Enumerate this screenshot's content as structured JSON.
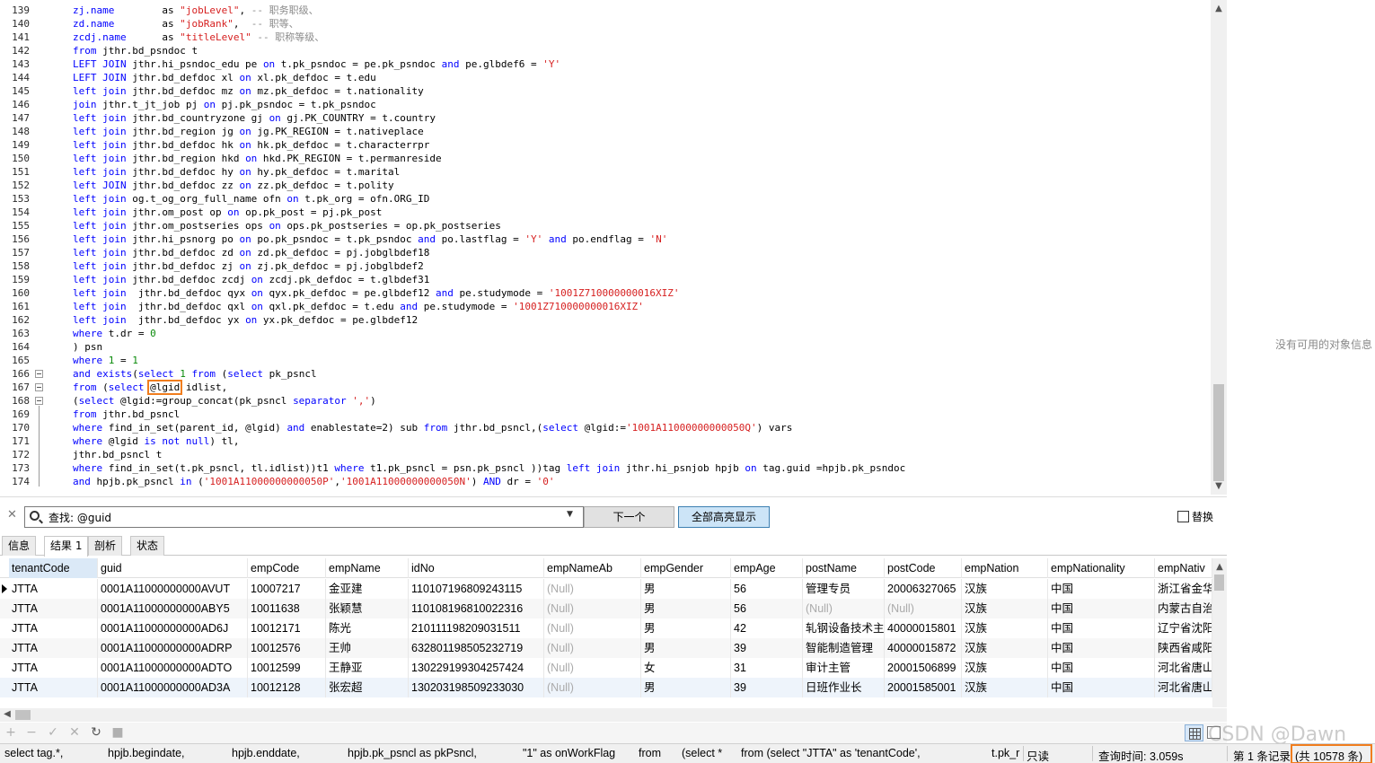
{
  "editor": {
    "lines": [
      {
        "n": "139",
        "segs": [
          {
            "t": "zj.name",
            "c": "kw"
          },
          {
            "t": "        as "
          },
          {
            "t": "\"jobLevel\"",
            "c": "str"
          },
          {
            "t": ", "
          },
          {
            "t": "-- 职务职级、",
            "c": "cm"
          }
        ]
      },
      {
        "n": "140",
        "segs": [
          {
            "t": "zd.name",
            "c": "kw"
          },
          {
            "t": "        as "
          },
          {
            "t": "\"jobRank\"",
            "c": "str"
          },
          {
            "t": ",  "
          },
          {
            "t": "-- 职等、",
            "c": "cm"
          }
        ]
      },
      {
        "n": "141",
        "segs": [
          {
            "t": "zcdj.name",
            "c": "kw"
          },
          {
            "t": "      as "
          },
          {
            "t": "\"titleLevel\"",
            "c": "str"
          },
          {
            "t": " "
          },
          {
            "t": "-- 职称等级、",
            "c": "cm"
          }
        ]
      },
      {
        "n": "142",
        "segs": [
          {
            "t": "from",
            "c": "kw"
          },
          {
            "t": " jthr.bd_psndoc t"
          }
        ]
      },
      {
        "n": "143",
        "segs": [
          {
            "t": "LEFT JOIN",
            "c": "kw"
          },
          {
            "t": " jthr.hi_psndoc_edu pe "
          },
          {
            "t": "on",
            "c": "kw"
          },
          {
            "t": " t.pk_psndoc = pe.pk_psndoc "
          },
          {
            "t": "and",
            "c": "kw"
          },
          {
            "t": " pe.glbdef6 = "
          },
          {
            "t": "'Y'",
            "c": "str"
          }
        ]
      },
      {
        "n": "144",
        "segs": [
          {
            "t": "LEFT JOIN",
            "c": "kw"
          },
          {
            "t": " jthr.bd_defdoc xl "
          },
          {
            "t": "on",
            "c": "kw"
          },
          {
            "t": " xl.pk_defdoc = t.edu"
          }
        ]
      },
      {
        "n": "145",
        "segs": [
          {
            "t": "left join",
            "c": "kw"
          },
          {
            "t": " jthr.bd_defdoc mz "
          },
          {
            "t": "on",
            "c": "kw"
          },
          {
            "t": " mz.pk_defdoc = t.nationality"
          }
        ]
      },
      {
        "n": "146",
        "segs": [
          {
            "t": "join",
            "c": "kw"
          },
          {
            "t": " jthr.t_jt_job pj "
          },
          {
            "t": "on",
            "c": "kw"
          },
          {
            "t": " pj.pk_psndoc = t.pk_psndoc"
          }
        ]
      },
      {
        "n": "147",
        "segs": [
          {
            "t": "left join",
            "c": "kw"
          },
          {
            "t": " jthr.bd_countryzone gj "
          },
          {
            "t": "on",
            "c": "kw"
          },
          {
            "t": " gj.PK_COUNTRY = t.country"
          }
        ]
      },
      {
        "n": "148",
        "segs": [
          {
            "t": "left join",
            "c": "kw"
          },
          {
            "t": " jthr.bd_region jg "
          },
          {
            "t": "on",
            "c": "kw"
          },
          {
            "t": " jg.PK_REGION = t.nativeplace"
          }
        ]
      },
      {
        "n": "149",
        "segs": [
          {
            "t": "left join",
            "c": "kw"
          },
          {
            "t": " jthr.bd_defdoc hk "
          },
          {
            "t": "on",
            "c": "kw"
          },
          {
            "t": " hk.pk_defdoc = t.characterrpr"
          }
        ]
      },
      {
        "n": "150",
        "segs": [
          {
            "t": "left join",
            "c": "kw"
          },
          {
            "t": " jthr.bd_region hkd "
          },
          {
            "t": "on",
            "c": "kw"
          },
          {
            "t": " hkd.PK_REGION = t.permanreside"
          }
        ]
      },
      {
        "n": "151",
        "segs": [
          {
            "t": "left join",
            "c": "kw"
          },
          {
            "t": " jthr.bd_defdoc hy "
          },
          {
            "t": "on",
            "c": "kw"
          },
          {
            "t": " hy.pk_defdoc = t.marital"
          }
        ]
      },
      {
        "n": "152",
        "segs": [
          {
            "t": "left JOIN",
            "c": "kw"
          },
          {
            "t": " jthr.bd_defdoc zz "
          },
          {
            "t": "on",
            "c": "kw"
          },
          {
            "t": " zz.pk_defdoc = t.polity"
          }
        ]
      },
      {
        "n": "153",
        "segs": [
          {
            "t": "left join",
            "c": "kw"
          },
          {
            "t": " og.t_og_org_full_name ofn "
          },
          {
            "t": "on",
            "c": "kw"
          },
          {
            "t": " t.pk_org = ofn.ORG_ID"
          }
        ]
      },
      {
        "n": "154",
        "segs": [
          {
            "t": "left join",
            "c": "kw"
          },
          {
            "t": " jthr.om_post op "
          },
          {
            "t": "on",
            "c": "kw"
          },
          {
            "t": " op.pk_post = pj.pk_post"
          }
        ]
      },
      {
        "n": "155",
        "segs": [
          {
            "t": "left join",
            "c": "kw"
          },
          {
            "t": " jthr.om_postseries ops "
          },
          {
            "t": "on",
            "c": "kw"
          },
          {
            "t": " ops.pk_postseries = op.pk_postseries"
          }
        ]
      },
      {
        "n": "156",
        "segs": [
          {
            "t": "left join",
            "c": "kw"
          },
          {
            "t": " jthr.hi_psnorg po "
          },
          {
            "t": "on",
            "c": "kw"
          },
          {
            "t": " po.pk_psndoc = t.pk_psndoc "
          },
          {
            "t": "and",
            "c": "kw"
          },
          {
            "t": " po.lastflag = "
          },
          {
            "t": "'Y'",
            "c": "str"
          },
          {
            "t": " "
          },
          {
            "t": "and",
            "c": "kw"
          },
          {
            "t": " po.endflag = "
          },
          {
            "t": "'N'",
            "c": "str"
          }
        ]
      },
      {
        "n": "157",
        "segs": [
          {
            "t": "left join",
            "c": "kw"
          },
          {
            "t": " jthr.bd_defdoc zd "
          },
          {
            "t": "on",
            "c": "kw"
          },
          {
            "t": " zd.pk_defdoc = pj.jobglbdef18"
          }
        ]
      },
      {
        "n": "158",
        "segs": [
          {
            "t": "left join",
            "c": "kw"
          },
          {
            "t": " jthr.bd_defdoc zj "
          },
          {
            "t": "on",
            "c": "kw"
          },
          {
            "t": " zj.pk_defdoc = pj.jobglbdef2"
          }
        ]
      },
      {
        "n": "159",
        "segs": [
          {
            "t": "left join",
            "c": "kw"
          },
          {
            "t": " jthr.bd_defdoc zcdj "
          },
          {
            "t": "on",
            "c": "kw"
          },
          {
            "t": " zcdj.pk_defdoc = t.glbdef31"
          }
        ]
      },
      {
        "n": "160",
        "segs": [
          {
            "t": "left join",
            "c": "kw"
          },
          {
            "t": "  jthr.bd_defdoc qyx "
          },
          {
            "t": "on",
            "c": "kw"
          },
          {
            "t": " qyx.pk_defdoc = pe.glbdef12 "
          },
          {
            "t": "and",
            "c": "kw"
          },
          {
            "t": " pe.studymode = "
          },
          {
            "t": "'1001Z710000000016XIZ'",
            "c": "str"
          }
        ]
      },
      {
        "n": "161",
        "segs": [
          {
            "t": "left join",
            "c": "kw"
          },
          {
            "t": "  jthr.bd_defdoc qxl "
          },
          {
            "t": "on",
            "c": "kw"
          },
          {
            "t": " qxl.pk_defdoc = t.edu "
          },
          {
            "t": "and",
            "c": "kw"
          },
          {
            "t": " pe.studymode = "
          },
          {
            "t": "'1001Z710000000016XIZ'",
            "c": "str"
          }
        ]
      },
      {
        "n": "162",
        "segs": [
          {
            "t": "left join",
            "c": "kw"
          },
          {
            "t": "  jthr.bd_defdoc yx "
          },
          {
            "t": "on",
            "c": "kw"
          },
          {
            "t": " yx.pk_defdoc = pe.glbdef12"
          }
        ]
      },
      {
        "n": "163",
        "segs": [
          {
            "t": "where",
            "c": "kw"
          },
          {
            "t": " t.dr = "
          },
          {
            "t": "0",
            "c": "num"
          }
        ]
      },
      {
        "n": "164",
        "segs": [
          {
            "t": ") psn"
          }
        ]
      },
      {
        "n": "165",
        "segs": [
          {
            "t": "where",
            "c": "kw"
          },
          {
            "t": " "
          },
          {
            "t": "1",
            "c": "num"
          },
          {
            "t": " = "
          },
          {
            "t": "1",
            "c": "num"
          }
        ]
      },
      {
        "n": "166",
        "segs": [
          {
            "t": "and exists",
            "c": "kw"
          },
          {
            "t": "("
          },
          {
            "t": "select",
            "c": "kw"
          },
          {
            "t": " "
          },
          {
            "t": "1",
            "c": "num"
          },
          {
            "t": " "
          },
          {
            "t": "from",
            "c": "kw"
          },
          {
            "t": " ("
          },
          {
            "t": "select",
            "c": "kw"
          },
          {
            "t": " pk_psncl"
          }
        ]
      },
      {
        "n": "167",
        "segs": [
          {
            "t": "from",
            "c": "kw"
          },
          {
            "t": " ("
          },
          {
            "t": "select",
            "c": "kw"
          },
          {
            "t": " "
          },
          {
            "t": "@lgid",
            "c": "box"
          },
          {
            "t": " idlist,"
          }
        ]
      },
      {
        "n": "168",
        "segs": [
          {
            "t": "("
          },
          {
            "t": "select",
            "c": "kw"
          },
          {
            "t": " @lgid:=group_concat(pk_psncl "
          },
          {
            "t": "separator",
            "c": "kw"
          },
          {
            "t": " "
          },
          {
            "t": "','",
            "c": "str"
          },
          {
            "t": ")"
          }
        ]
      },
      {
        "n": "169",
        "segs": [
          {
            "t": "from",
            "c": "kw"
          },
          {
            "t": " jthr.bd_psncl"
          }
        ]
      },
      {
        "n": "170",
        "segs": [
          {
            "t": "where",
            "c": "kw"
          },
          {
            "t": " find_in_set(parent_id, @lgid) "
          },
          {
            "t": "and",
            "c": "kw"
          },
          {
            "t": " enablestate=2) sub "
          },
          {
            "t": "from",
            "c": "kw"
          },
          {
            "t": " jthr.bd_psncl,("
          },
          {
            "t": "select",
            "c": "kw"
          },
          {
            "t": " @lgid:="
          },
          {
            "t": "'1001A11000000000050Q'",
            "c": "str"
          },
          {
            "t": ") vars"
          }
        ]
      },
      {
        "n": "171",
        "segs": [
          {
            "t": "where",
            "c": "kw"
          },
          {
            "t": " @lgid "
          },
          {
            "t": "is not null",
            "c": "kw"
          },
          {
            "t": ") tl,"
          }
        ]
      },
      {
        "n": "172",
        "segs": [
          {
            "t": "jthr.bd_psncl t"
          }
        ]
      },
      {
        "n": "173",
        "segs": [
          {
            "t": "where",
            "c": "kw"
          },
          {
            "t": " find_in_set(t.pk_psncl, tl.idlist))t1 "
          },
          {
            "t": "where",
            "c": "kw"
          },
          {
            "t": " t1.pk_psncl = psn.pk_psncl ))tag "
          },
          {
            "t": "left join",
            "c": "kw"
          },
          {
            "t": " jthr.hi_psnjob hpjb "
          },
          {
            "t": "on",
            "c": "kw"
          },
          {
            "t": " tag.guid =hpjb.pk_psndoc"
          }
        ]
      },
      {
        "n": "174",
        "segs": [
          {
            "t": "and",
            "c": "kw"
          },
          {
            "t": " hpjb.pk_psncl "
          },
          {
            "t": "in",
            "c": "kw"
          },
          {
            "t": " ("
          },
          {
            "t": "'1001A11000000000050P'",
            "c": "str"
          },
          {
            "t": ","
          },
          {
            "t": "'1001A11000000000050N'",
            "c": "str"
          },
          {
            "t": ") "
          },
          {
            "t": "AND",
            "c": "kw"
          },
          {
            "t": " dr = "
          },
          {
            "t": "'0'",
            "c": "str"
          }
        ]
      }
    ]
  },
  "right_pane": {
    "message": "没有可用的对象信息"
  },
  "find": {
    "value": "查找: @guid",
    "next_label": "下一个",
    "highlight_all_label": "全部高亮显示",
    "replace_label": "替换"
  },
  "tabs": [
    "信息",
    "结果 1",
    "剖析",
    "状态"
  ],
  "grid": {
    "columns": [
      "tenantCode",
      "guid",
      "empCode",
      "empName",
      "idNo",
      "empNameAb",
      "empGender",
      "empAge",
      "postName",
      "postCode",
      "empNation",
      "empNationality",
      "empNativ"
    ],
    "rows": [
      [
        "JTTA",
        "0001A11000000000AVUT",
        "10007217",
        "金亚建",
        "110107196809243115",
        "(Null)",
        "男",
        "56",
        "管理专员",
        "20006327065",
        "汉族",
        "中国",
        "浙江省金华"
      ],
      [
        "JTTA",
        "0001A11000000000ABY5",
        "10011638",
        "张颖慧",
        "110108196810022316",
        "(Null)",
        "男",
        "56",
        "(Null)",
        "(Null)",
        "汉族",
        "中国",
        "内蒙古自治"
      ],
      [
        "JTTA",
        "0001A11000000000AD6J",
        "10012171",
        "陈光",
        "210111198209031511",
        "(Null)",
        "男",
        "42",
        "轧钢设备技术主管",
        "40000015801",
        "汉族",
        "中国",
        "辽宁省沈阳"
      ],
      [
        "JTTA",
        "0001A11000000000ADRP",
        "10012576",
        "王帅",
        "632801198505232719",
        "(Null)",
        "男",
        "39",
        "智能制造管理",
        "40000015872",
        "汉族",
        "中国",
        "陕西省咸阳"
      ],
      [
        "JTTA",
        "0001A11000000000ADTO",
        "10012599",
        "王静亚",
        "130229199304257424",
        "(Null)",
        "女",
        "31",
        "审计主管",
        "20001506899",
        "汉族",
        "中国",
        "河北省唐山"
      ],
      [
        "JTTA",
        "0001A11000000000AD3A",
        "10012128",
        "张宏超",
        "130203198509233030",
        "(Null)",
        "男",
        "39",
        "日班作业长",
        "20001585001",
        "汉族",
        "中国",
        "河北省唐山"
      ]
    ]
  },
  "status": {
    "segments": [
      "select tag.*,",
      "hpjb.begindate,",
      "hpjb.enddate,",
      "hpjb.pk_psncl as pkPsncl,",
      "\"1\" as onWorkFlag",
      "from",
      "(select *",
      "from (select \"JTTA\" as 'tenantCode',",
      "t.pk_r"
    ],
    "readonly": "只读",
    "query_time": "查询时间: 3.059s",
    "record": "第 1 条记录",
    "count": "(共 10578 条)"
  },
  "watermark": "CSDN @Dawn"
}
